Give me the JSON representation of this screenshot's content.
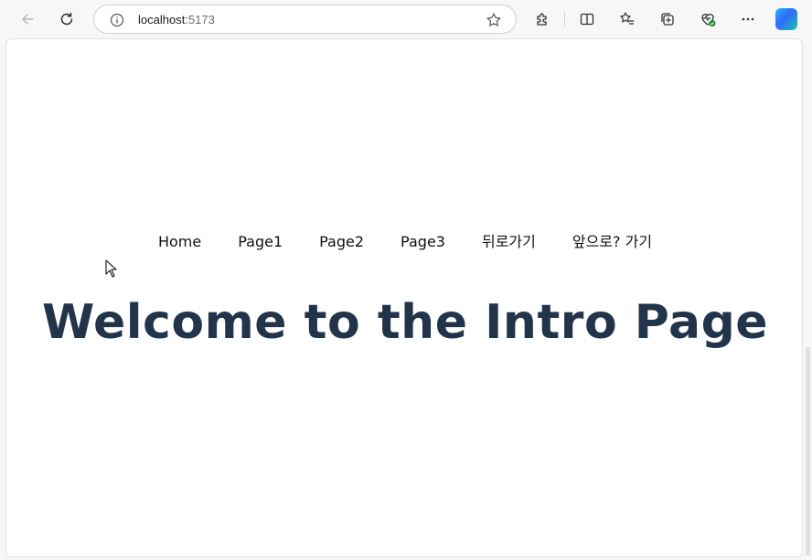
{
  "browser": {
    "url_host": "localhost",
    "url_port": ":5173"
  },
  "nav": {
    "items": [
      {
        "label": "Home"
      },
      {
        "label": "Page1"
      },
      {
        "label": "Page2"
      },
      {
        "label": "Page3"
      },
      {
        "label": "뒤로가기"
      },
      {
        "label": "앞으로? 가기"
      }
    ]
  },
  "main": {
    "heading": "Welcome to the Intro Page"
  },
  "colors": {
    "heading": "#22344a",
    "nav_text": "#111111"
  }
}
